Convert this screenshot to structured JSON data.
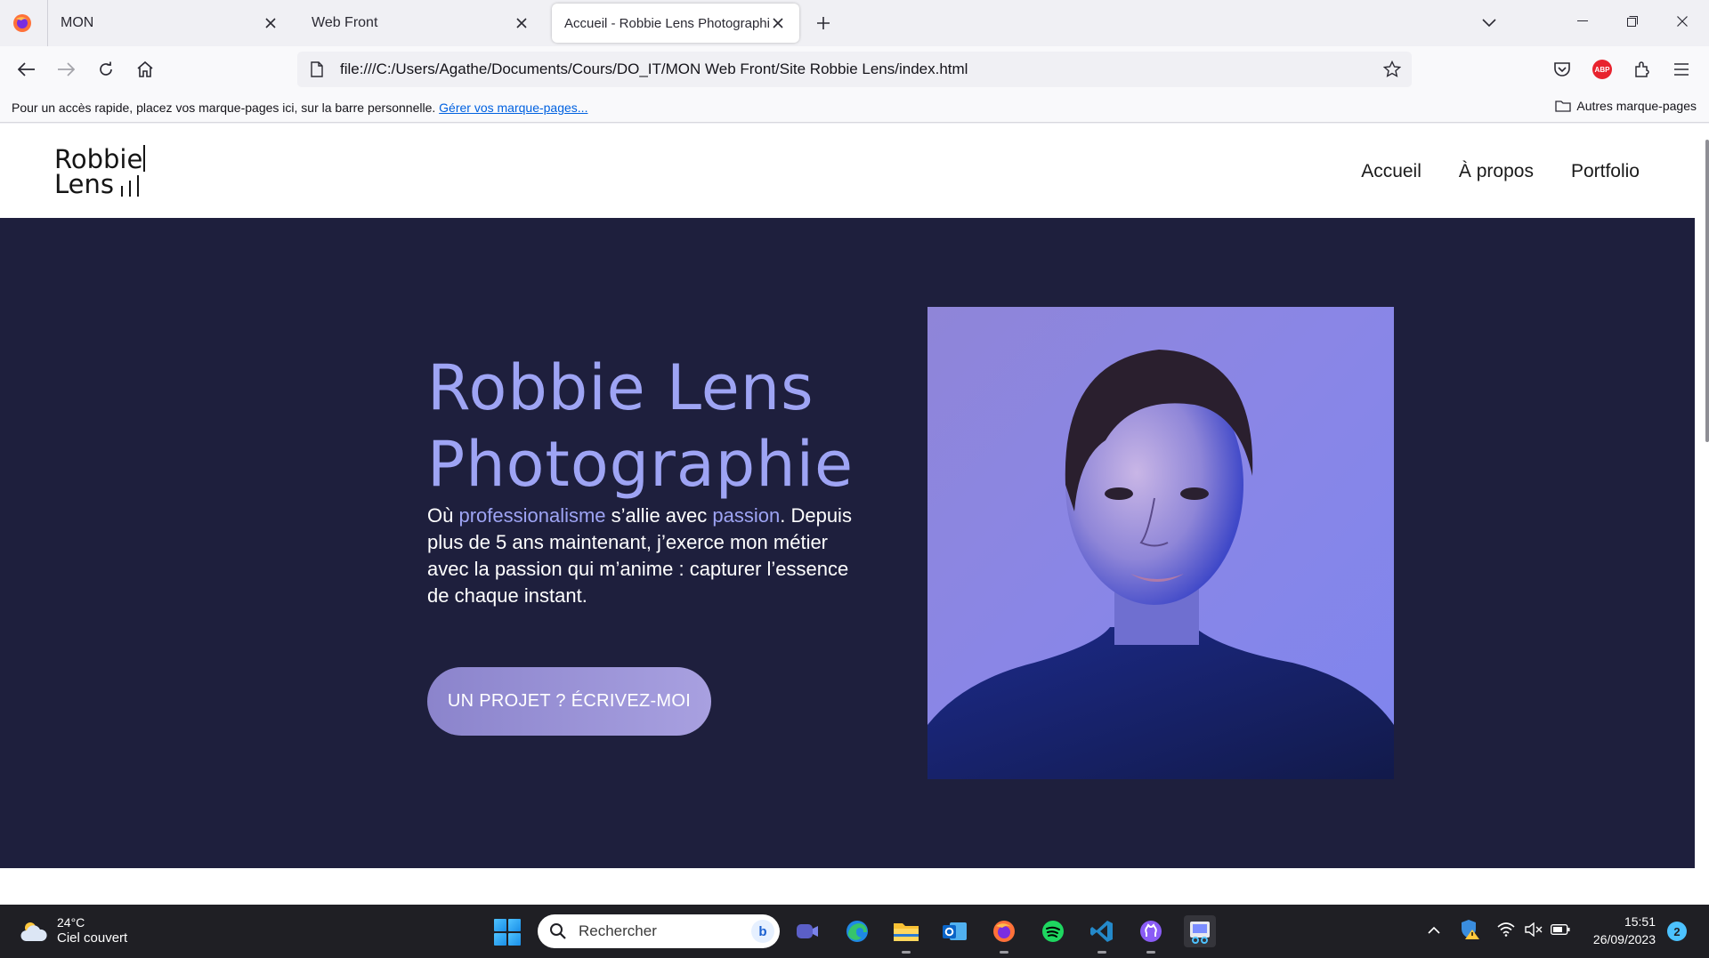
{
  "browser": {
    "tabs": [
      {
        "title": "MON",
        "active": false
      },
      {
        "title": "Web Front",
        "active": false
      },
      {
        "title": "Accueil - Robbie Lens Photographie",
        "active": true
      }
    ],
    "url": "file:///C:/Users/Agathe/Documents/Cours/DO_IT/MON Web Front/Site Robbie Lens/index.html",
    "bookmarks_bar": {
      "hint": "Pour un accès rapide, placez vos marque-pages ici, sur la barre personnelle.",
      "manage_link": "Gérer vos marque-pages...",
      "other_bookmarks": "Autres marque-pages"
    }
  },
  "site": {
    "logo": {
      "line1": "Robbie",
      "line2": "Lens"
    },
    "nav": [
      "Accueil",
      "À propos",
      "Portfolio"
    ],
    "hero": {
      "title_line1": "Robbie Lens",
      "title_line2": "Photographie",
      "text_part1": "Où ",
      "text_accent1": "professionalisme",
      "text_part2": " s’allie avec ",
      "text_accent2": "passion",
      "text_part3": ". Depuis plus de 5 ans maintenant, j’exerce mon métier avec la passion qui m’anime : capturer l’essence de chaque instant.",
      "cta": "UN PROJET ? ÉCRIVEZ-MOI"
    },
    "colors": {
      "hero_bg": "#1e1f3d",
      "accent": "#9ea4f4",
      "button": "#9a93d8"
    }
  },
  "taskbar": {
    "weather": {
      "temp": "24°C",
      "condition": "Ciel couvert"
    },
    "search_placeholder": "Rechercher",
    "apps": [
      "teams-icon",
      "edge-icon",
      "file-explorer-icon",
      "outlook-icon",
      "firefox-icon",
      "spotify-icon",
      "vscode-icon",
      "github-desktop-icon",
      "snipping-tool-icon"
    ],
    "clock": {
      "time": "15:51",
      "date": "26/09/2023"
    },
    "notifications": "2"
  }
}
